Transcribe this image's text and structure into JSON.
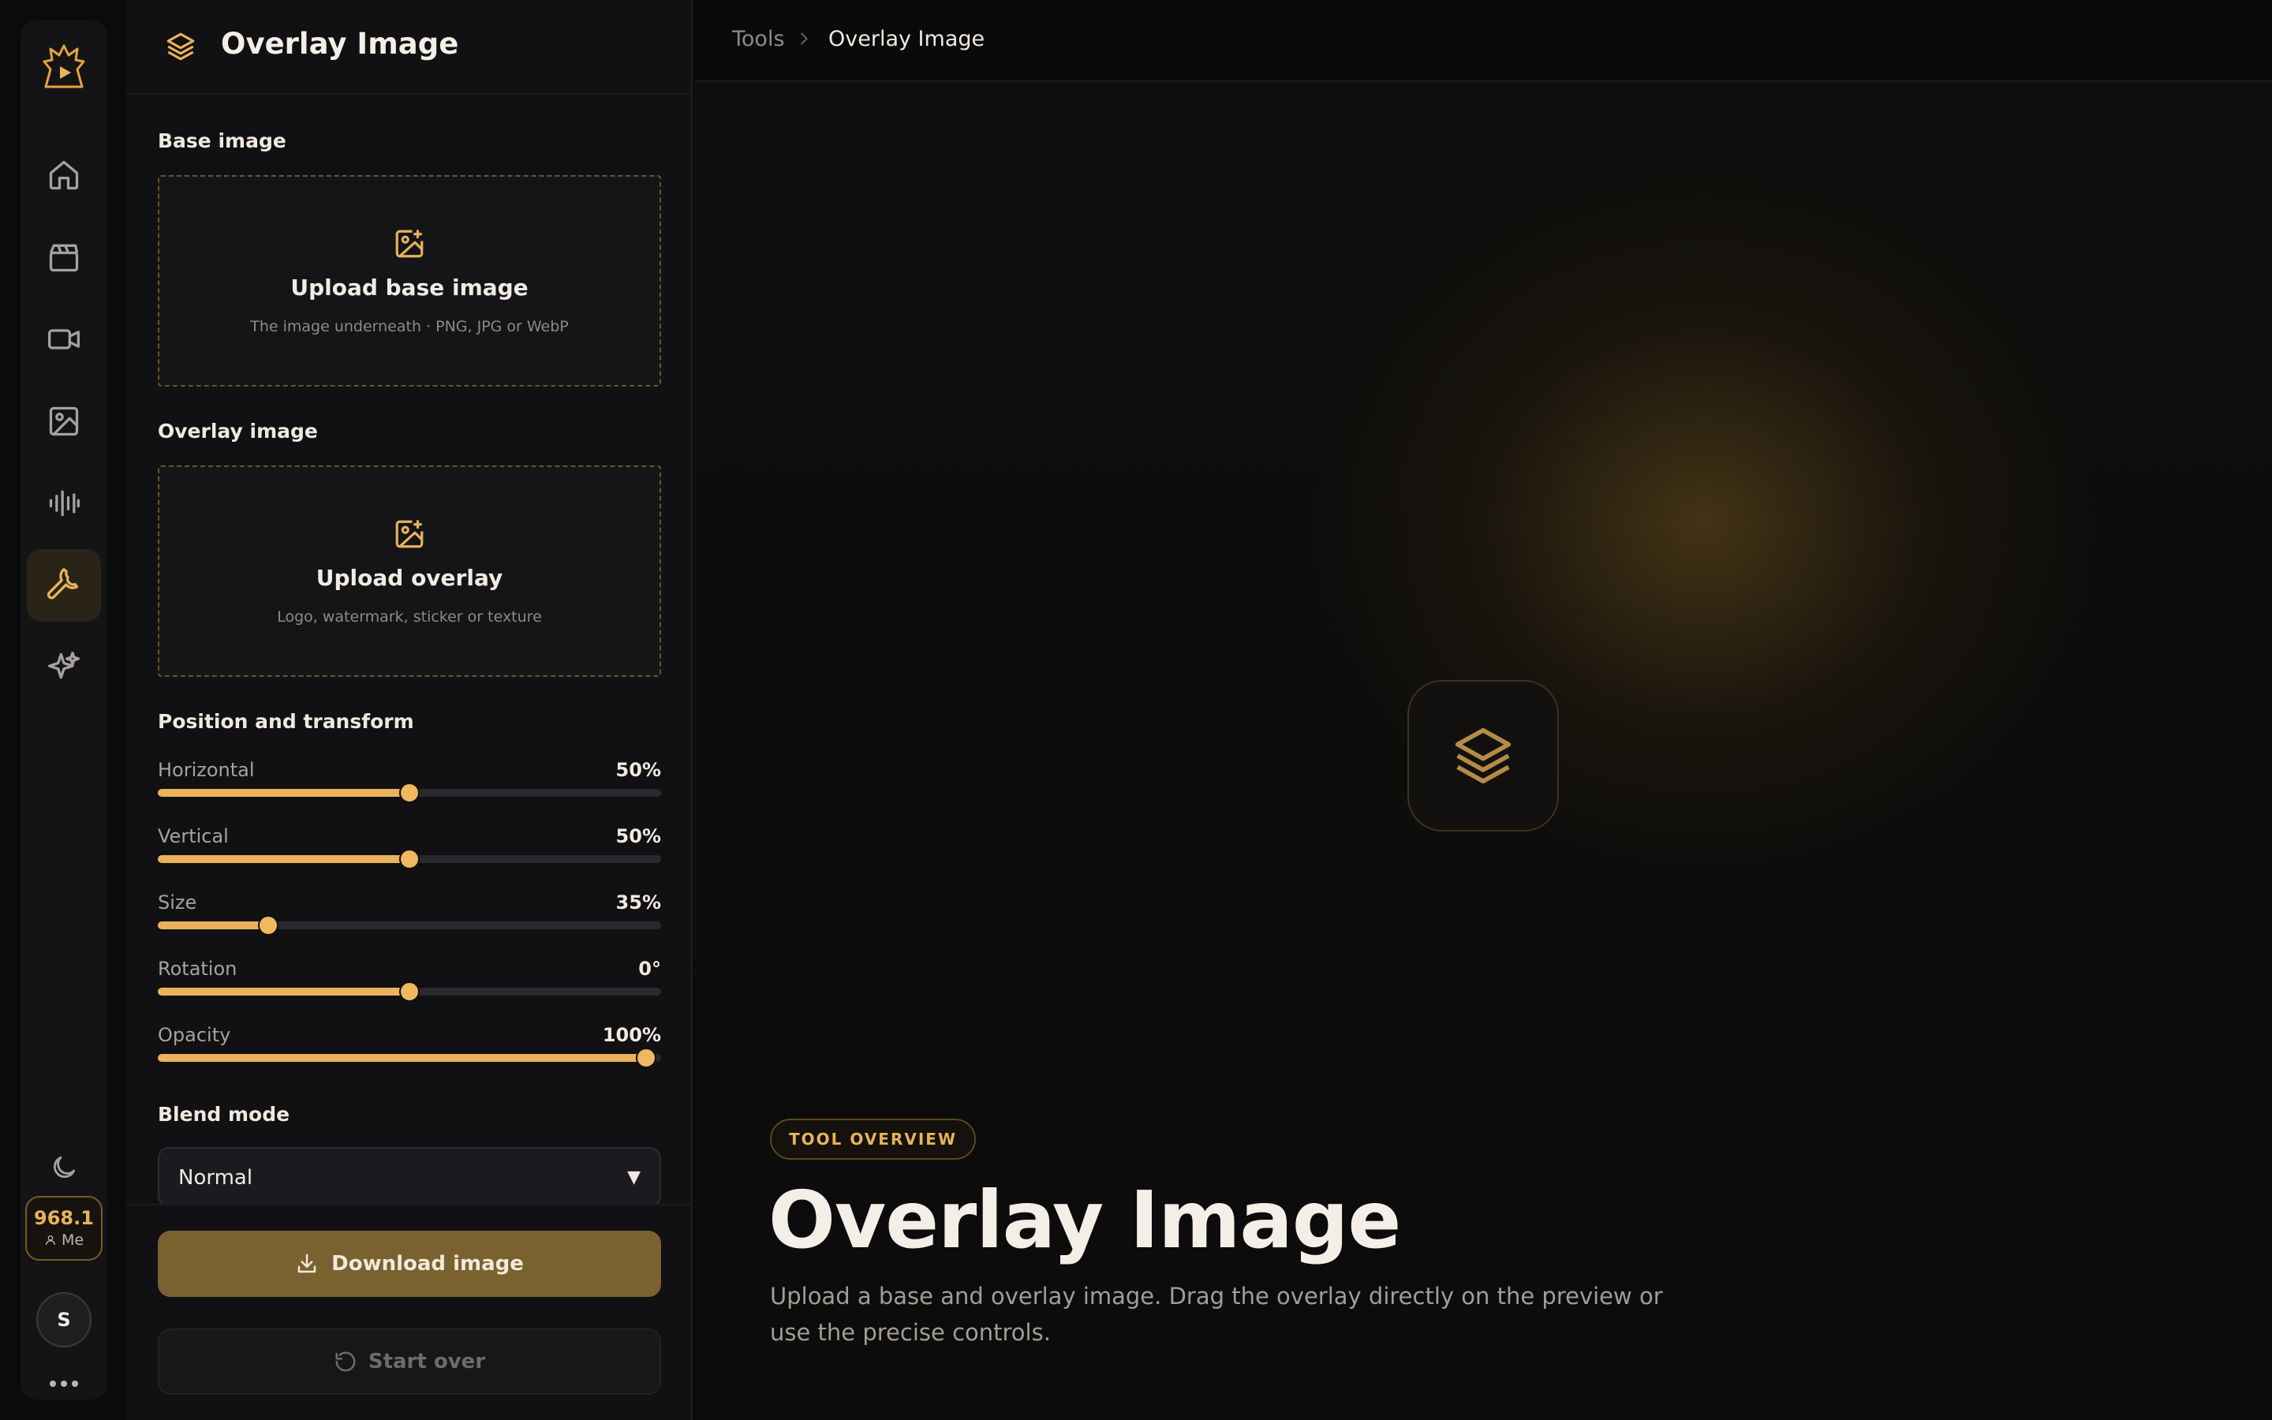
{
  "rail": {
    "credits": "968.1",
    "me_label": "Me",
    "avatar_initial": "S",
    "items": [
      "home-icon",
      "clapperboard-icon",
      "video-camera-icon",
      "image-icon",
      "audio-waveform-icon",
      "wrench-icon",
      "sparkles-icon"
    ],
    "active_item": "wrench-icon"
  },
  "panel": {
    "title": "Overlay Image",
    "base_section": "Base image",
    "base_upload": {
      "title": "Upload base image",
      "subtitle": "The image underneath · PNG, JPG or WebP"
    },
    "overlay_section": "Overlay image",
    "overlay_upload": {
      "title": "Upload overlay",
      "subtitle": "Logo, watermark, sticker or texture"
    },
    "transform_section": "Position and transform",
    "sliders": [
      {
        "label": "Horizontal",
        "value": "50%",
        "fraction": 0.5
      },
      {
        "label": "Vertical",
        "value": "50%",
        "fraction": 0.5
      },
      {
        "label": "Size",
        "value": "35%",
        "fraction": 0.22
      },
      {
        "label": "Rotation",
        "value": "0°",
        "fraction": 0.5
      },
      {
        "label": "Opacity",
        "value": "100%",
        "fraction": 0.97
      }
    ],
    "blend_section": "Blend mode",
    "blend_value": "Normal",
    "download_label": "Download image",
    "start_over_label": "Start over"
  },
  "breadcrumb": {
    "root": "Tools",
    "current": "Overlay Image"
  },
  "hero": {
    "badge": "TOOL OVERVIEW",
    "title": "Overlay Image",
    "description": "Upload a base and overlay image. Drag the overlay directly on the preview or use the precise controls."
  },
  "colors": {
    "accent": "#e8b35a",
    "download_button": "#7a6130",
    "background": "#0b0b0c"
  }
}
